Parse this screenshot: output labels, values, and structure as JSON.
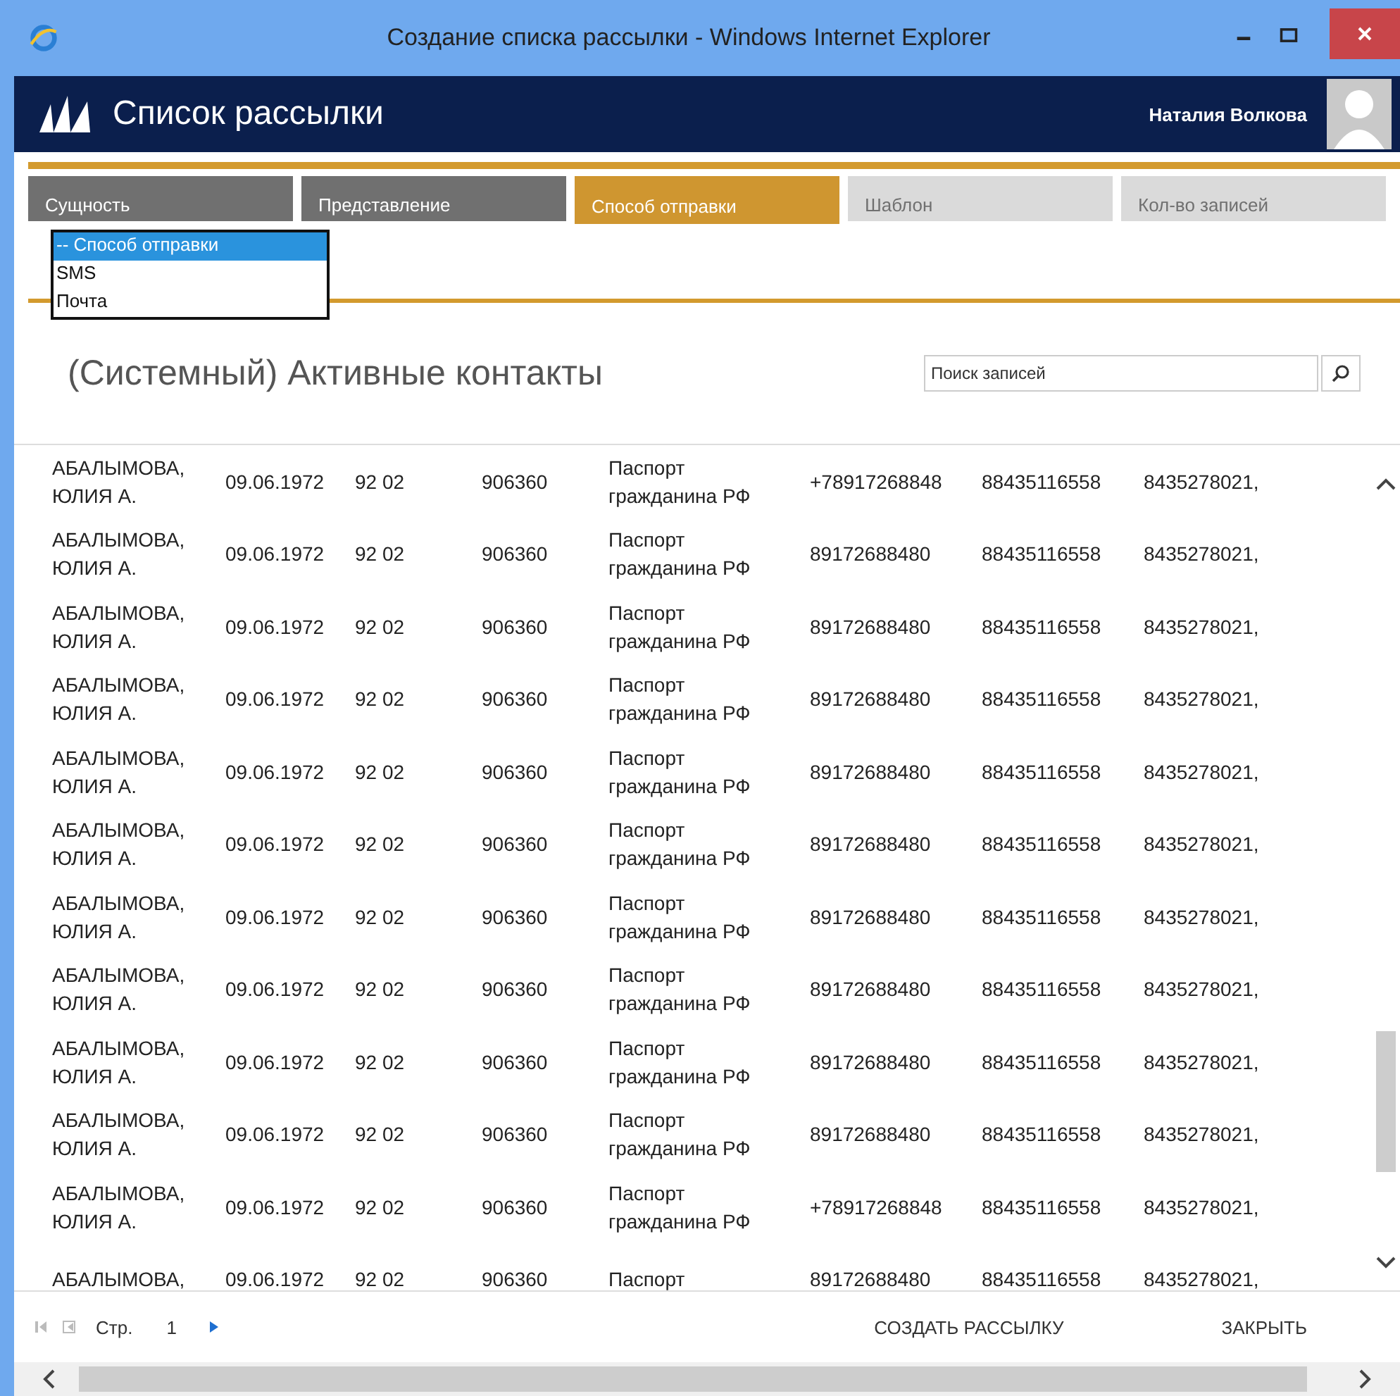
{
  "window": {
    "title": "Создание списка рассылки - Windows Internet Explorer"
  },
  "app": {
    "title": "Список рассылки",
    "user": "Наталия Волкова"
  },
  "tabs": [
    {
      "label": "Сущность",
      "selected": false,
      "disabled": false
    },
    {
      "label": "Представление",
      "selected": false,
      "disabled": false
    },
    {
      "label": "Способ отправки",
      "selected": true,
      "disabled": false
    },
    {
      "label": "Шаблон",
      "selected": false,
      "disabled": true
    },
    {
      "label": "Кол-во записей",
      "selected": false,
      "disabled": true
    }
  ],
  "dropdown": {
    "options": [
      {
        "label": "-- Способ отправки",
        "selected": true
      },
      {
        "label": "SMS",
        "selected": false
      },
      {
        "label": "Почта",
        "selected": false
      }
    ]
  },
  "view_title": "(Системный) Активные контакты",
  "search": {
    "placeholder": "Поиск записей"
  },
  "rows": [
    {
      "name": "АБАЛЫМОВА, ЮЛИЯ А.",
      "birth": "09.06.1972",
      "series": "92 02",
      "number": "906360",
      "doc": "Паспорт гражданина РФ",
      "phone": "+78917268848",
      "phone2": "88435116558",
      "phone3": "8435278021,"
    },
    {
      "name": "АБАЛЫМОВА, ЮЛИЯ А.",
      "birth": "09.06.1972",
      "series": "92 02",
      "number": "906360",
      "doc": "Паспорт гражданина РФ",
      "phone": "89172688480",
      "phone2": "88435116558",
      "phone3": "8435278021,"
    },
    {
      "name": "АБАЛЫМОВА, ЮЛИЯ А.",
      "birth": "09.06.1972",
      "series": "92 02",
      "number": "906360",
      "doc": "Паспорт гражданина РФ",
      "phone": "89172688480",
      "phone2": "88435116558",
      "phone3": "8435278021,"
    },
    {
      "name": "АБАЛЫМОВА, ЮЛИЯ А.",
      "birth": "09.06.1972",
      "series": "92 02",
      "number": "906360",
      "doc": "Паспорт гражданина РФ",
      "phone": "89172688480",
      "phone2": "88435116558",
      "phone3": "8435278021,"
    },
    {
      "name": "АБАЛЫМОВА, ЮЛИЯ А.",
      "birth": "09.06.1972",
      "series": "92 02",
      "number": "906360",
      "doc": "Паспорт гражданина РФ",
      "phone": "89172688480",
      "phone2": "88435116558",
      "phone3": "8435278021,"
    },
    {
      "name": "АБАЛЫМОВА, ЮЛИЯ А.",
      "birth": "09.06.1972",
      "series": "92 02",
      "number": "906360",
      "doc": "Паспорт гражданина РФ",
      "phone": "89172688480",
      "phone2": "88435116558",
      "phone3": "8435278021,"
    },
    {
      "name": "АБАЛЫМОВА, ЮЛИЯ А.",
      "birth": "09.06.1972",
      "series": "92 02",
      "number": "906360",
      "doc": "Паспорт гражданина РФ",
      "phone": "89172688480",
      "phone2": "88435116558",
      "phone3": "8435278021,"
    },
    {
      "name": "АБАЛЫМОВА, ЮЛИЯ А.",
      "birth": "09.06.1972",
      "series": "92 02",
      "number": "906360",
      "doc": "Паспорт гражданина РФ",
      "phone": "89172688480",
      "phone2": "88435116558",
      "phone3": "8435278021,"
    },
    {
      "name": "АБАЛЫМОВА, ЮЛИЯ А.",
      "birth": "09.06.1972",
      "series": "92 02",
      "number": "906360",
      "doc": "Паспорт гражданина РФ",
      "phone": "89172688480",
      "phone2": "88435116558",
      "phone3": "8435278021,"
    },
    {
      "name": "АБАЛЫМОВА, ЮЛИЯ А.",
      "birth": "09.06.1972",
      "series": "92 02",
      "number": "906360",
      "doc": "Паспорт гражданина РФ",
      "phone": "89172688480",
      "phone2": "88435116558",
      "phone3": "8435278021,"
    },
    {
      "name": "АБАЛЫМОВА, ЮЛИЯ А.",
      "birth": "09.06.1972",
      "series": "92 02",
      "number": "906360",
      "doc": "Паспорт гражданина РФ",
      "phone": "+78917268848",
      "phone2": "88435116558",
      "phone3": "8435278021,"
    },
    {
      "name": "АБАЛЫМОВА,",
      "birth": "09.06.1972",
      "series": "92 02",
      "number": "906360",
      "doc": "Паспорт",
      "phone": "89172688480",
      "phone2": "88435116558",
      "phone3": "8435278021,"
    }
  ],
  "pager": {
    "label": "Стр.",
    "page": "1"
  },
  "actions": [
    "СОЗДАТЬ РАССЫЛКУ",
    "ЗАКРЫТЬ"
  ]
}
